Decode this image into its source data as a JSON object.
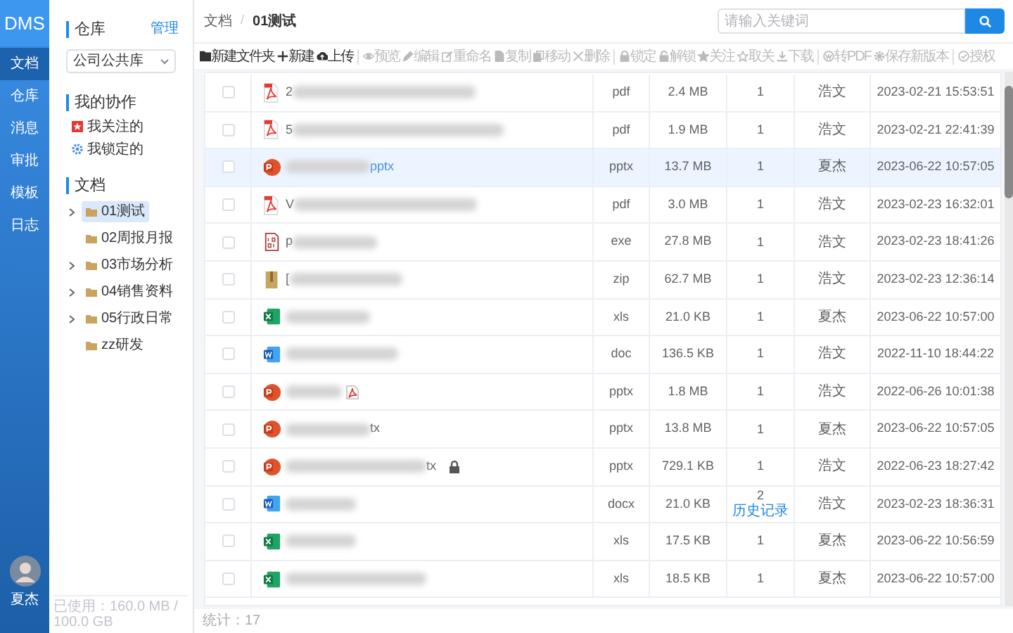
{
  "app": {
    "logo": "DMS"
  },
  "nav": [
    {
      "label": "文档",
      "selected": true
    },
    {
      "label": "仓库",
      "selected": false
    },
    {
      "label": "消息",
      "selected": false
    },
    {
      "label": "审批",
      "selected": false
    },
    {
      "label": "模板",
      "selected": false
    },
    {
      "label": "日志",
      "selected": false
    }
  ],
  "user": {
    "name": "夏杰"
  },
  "sidebar": {
    "repo_title": "仓库",
    "manage_link": "管理",
    "repo_select": "公司公共库",
    "collab_title": "我的协作",
    "collab_items": [
      {
        "label": "我关注的"
      },
      {
        "label": "我锁定的"
      }
    ],
    "docs_title": "文档",
    "tree": [
      {
        "label": "01测试",
        "expandable": true,
        "selected": true
      },
      {
        "label": "02周报月报",
        "expandable": false,
        "selected": false
      },
      {
        "label": "03市场分析",
        "expandable": true,
        "selected": false
      },
      {
        "label": "04销售资料",
        "expandable": true,
        "selected": false
      },
      {
        "label": "05行政日常",
        "expandable": true,
        "selected": false
      },
      {
        "label": "zz研发",
        "expandable": false,
        "selected": false
      }
    ],
    "usage": "已使用：160.0 MB / 100.0 GB"
  },
  "breadcrumb": [
    "文档",
    "01测试"
  ],
  "breadcrumb_separator": "/",
  "search": {
    "placeholder": "请输入关键词"
  },
  "toolbar": [
    {
      "label": "新建文件夹",
      "disabled": false
    },
    {
      "label": "新建",
      "disabled": false
    },
    {
      "label": "上传",
      "disabled": false
    },
    {
      "label": "预览",
      "disabled": true
    },
    {
      "label": "编辑",
      "disabled": true
    },
    {
      "label": "重命名",
      "disabled": true
    },
    {
      "label": "复制",
      "disabled": true
    },
    {
      "label": "移动",
      "disabled": true
    },
    {
      "label": "删除",
      "disabled": true
    },
    {
      "label": "锁定",
      "disabled": true
    },
    {
      "label": "解锁",
      "disabled": true
    },
    {
      "label": "关注",
      "disabled": true
    },
    {
      "label": "取关",
      "disabled": true
    },
    {
      "label": "下载",
      "disabled": true
    },
    {
      "label": "转PDF",
      "disabled": true
    },
    {
      "label": "保存新版本",
      "disabled": true
    },
    {
      "label": "授权",
      "disabled": true
    }
  ],
  "table": {
    "rows": [
      {
        "kind": "pdf",
        "name_start": "2",
        "type": "pdf",
        "size": "2.4 MB",
        "version": "1",
        "author": "浩文",
        "time": "2023-02-21 15:53:51",
        "selected": false
      },
      {
        "kind": "pdf",
        "name_start": "5",
        "type": "pdf",
        "size": "1.9 MB",
        "version": "1",
        "author": "浩文",
        "time": "2023-02-21 22:41:39",
        "selected": false
      },
      {
        "kind": "ppt",
        "name_end": "pptx",
        "type": "pptx",
        "size": "13.7 MB",
        "version": "1",
        "author": "夏杰",
        "time": "2023-06-22 10:57:05",
        "selected": true
      },
      {
        "kind": "pdf",
        "name_start": "V",
        "type": "pdf",
        "size": "3.0 MB",
        "version": "1",
        "author": "浩文",
        "time": "2023-02-23 16:32:01",
        "selected": false
      },
      {
        "kind": "exe",
        "name_start": "p",
        "type": "exe",
        "size": "27.8 MB",
        "version": "1",
        "author": "浩文",
        "time": "2023-02-23 18:41:26",
        "selected": false
      },
      {
        "kind": "zip",
        "name_start": "[",
        "type": "zip",
        "size": "62.7 MB",
        "version": "1",
        "author": "浩文",
        "time": "2023-02-23 12:36:14",
        "selected": false
      },
      {
        "kind": "excel",
        "type": "xls",
        "size": "21.0 KB",
        "version": "1",
        "author": "夏杰",
        "time": "2023-06-22 10:57:00",
        "selected": false
      },
      {
        "kind": "word",
        "type": "doc",
        "size": "136.5 KB",
        "version": "1",
        "author": "浩文",
        "time": "2022-11-10 18:44:22",
        "selected": false
      },
      {
        "kind": "ppt",
        "has_pdf": true,
        "type": "pptx",
        "size": "1.8 MB",
        "version": "1",
        "author": "浩文",
        "time": "2022-06-26 10:01:38",
        "selected": false
      },
      {
        "kind": "ppt",
        "name_end": "tx",
        "type": "pptx",
        "size": "13.8 MB",
        "version": "1",
        "author": "夏杰",
        "time": "2023-06-22 10:57:05",
        "selected": false
      },
      {
        "kind": "ppt",
        "name_end": "tx",
        "locked": true,
        "type": "pptx",
        "size": "729.1 KB",
        "version": "1",
        "author": "浩文",
        "time": "2022-06-23 18:27:42",
        "selected": false
      },
      {
        "kind": "word",
        "type": "docx",
        "size": "21.0 KB",
        "version": "2",
        "history_link": "历史记录",
        "author": "浩文",
        "time": "2023-02-23 18:36:31",
        "selected": false
      },
      {
        "kind": "excel",
        "type": "xls",
        "size": "17.5 KB",
        "version": "1",
        "author": "夏杰",
        "time": "2023-06-22 10:56:59",
        "selected": false
      },
      {
        "kind": "excel",
        "type": "xls",
        "size": "18.5 KB",
        "version": "1",
        "author": "夏杰",
        "time": "2023-06-22 10:57:00",
        "selected": false
      }
    ]
  },
  "footer": {
    "count": "统计：17"
  }
}
